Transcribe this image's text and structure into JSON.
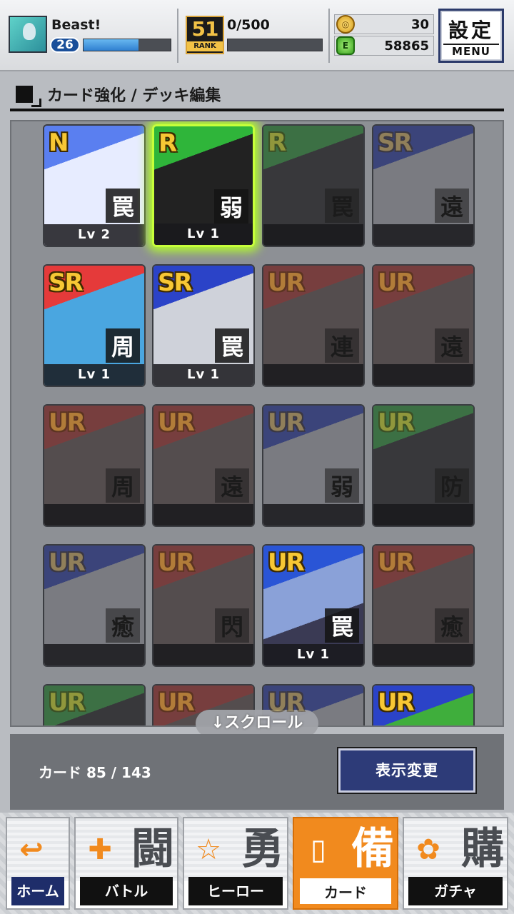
{
  "status": {
    "player_name": "Beast!",
    "level": "26",
    "exp_progress": 0.63,
    "rank_number": "51",
    "rank_label": "RANK",
    "rank_progress": "0/500",
    "coins": "30",
    "energy": "58865",
    "coin_icon": "coin-icon",
    "energy_icon": "energy-drink-icon"
  },
  "settings": {
    "kanji": "設定",
    "menu": "MENU"
  },
  "section": {
    "title": "カード強化 / デッキ編集"
  },
  "cards": [
    {
      "rarity": "N",
      "type": "罠",
      "level": "Lv 2",
      "locked": false
    },
    {
      "rarity": "R",
      "type": "弱",
      "level": "Lv 1",
      "locked": false,
      "selected": true
    },
    {
      "rarity": "R",
      "type": "罠",
      "level": "",
      "locked": true
    },
    {
      "rarity": "SR",
      "type": "遠",
      "level": "",
      "locked": true
    },
    {
      "rarity": "SR",
      "type": "周",
      "level": "Lv 1",
      "locked": false
    },
    {
      "rarity": "SR",
      "type": "罠",
      "level": "Lv 1",
      "locked": false
    },
    {
      "rarity": "UR",
      "type": "連",
      "level": "",
      "locked": true
    },
    {
      "rarity": "UR",
      "type": "遠",
      "level": "",
      "locked": true
    },
    {
      "rarity": "UR",
      "type": "周",
      "level": "",
      "locked": true
    },
    {
      "rarity": "UR",
      "type": "遠",
      "level": "",
      "locked": true
    },
    {
      "rarity": "UR",
      "type": "弱",
      "level": "",
      "locked": true
    },
    {
      "rarity": "UR",
      "type": "防",
      "level": "",
      "locked": true
    },
    {
      "rarity": "UR",
      "type": "癒",
      "level": "",
      "locked": true
    },
    {
      "rarity": "UR",
      "type": "閃",
      "level": "",
      "locked": true
    },
    {
      "rarity": "UR",
      "type": "罠",
      "level": "Lv 1",
      "locked": false
    },
    {
      "rarity": "UR",
      "type": "癒",
      "level": "",
      "locked": true
    },
    {
      "rarity": "UR",
      "type": "",
      "level": "",
      "locked": true
    },
    {
      "rarity": "UR",
      "type": "",
      "level": "",
      "locked": true
    },
    {
      "rarity": "UR",
      "type": "",
      "level": "",
      "locked": true
    },
    {
      "rarity": "UR",
      "type": "",
      "level": "",
      "locked": false
    }
  ],
  "scroll_hint": "↓スクロール",
  "footer": {
    "card_count": "カード 85 / 143",
    "view_button": "表示変更"
  },
  "tabs": [
    {
      "label": "ホーム",
      "kanji": "",
      "icon": "↩"
    },
    {
      "label": "バトル",
      "kanji": "闘",
      "icon": "✚"
    },
    {
      "label": "ヒーロー",
      "kanji": "勇",
      "icon": "☆"
    },
    {
      "label": "カード",
      "kanji": "備",
      "icon": "▯"
    },
    {
      "label": "ガチャ",
      "kanji": "購",
      "icon": "✿"
    }
  ]
}
